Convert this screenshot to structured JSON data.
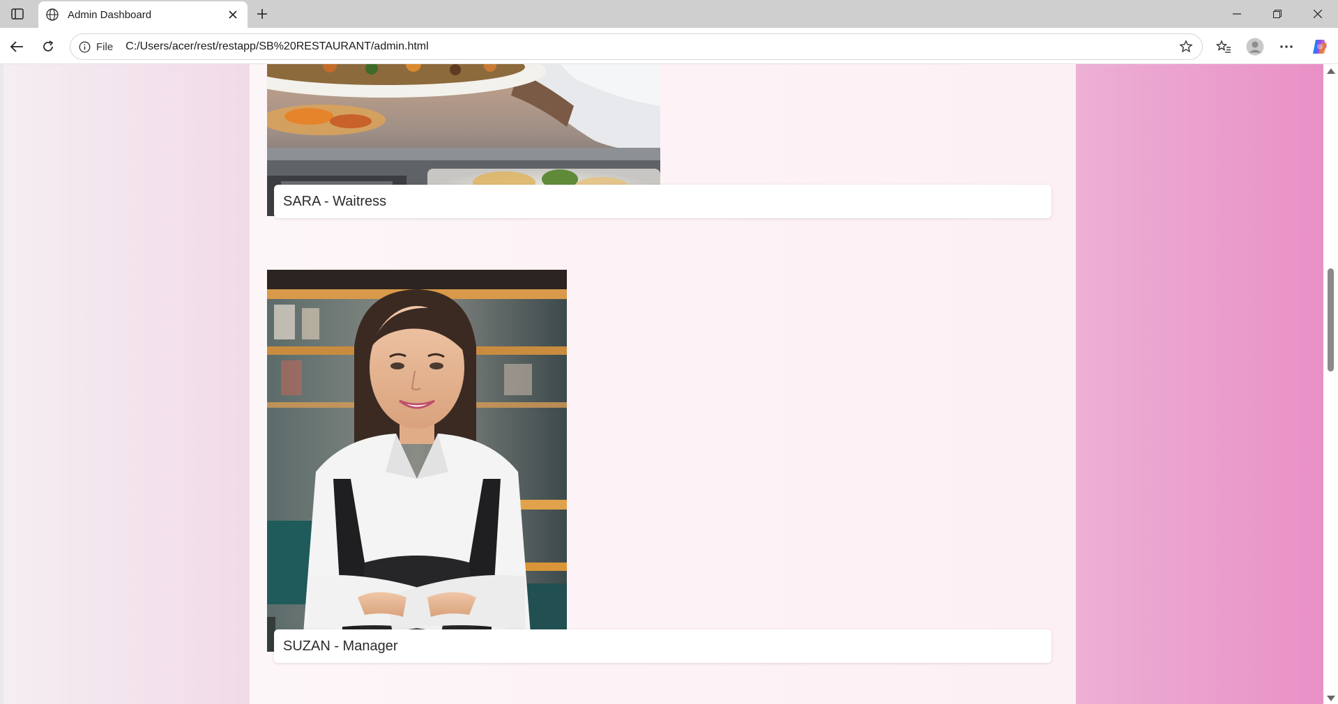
{
  "browser": {
    "tab_title": "Admin Dashboard",
    "address_scheme_label": "File",
    "url": "C:/Users/acer/rest/restapp/SB%20RESTAURANT/admin.html"
  },
  "page": {
    "staff": [
      {
        "label": "SARA - Waitress"
      },
      {
        "label": "SUZAN - Manager"
      }
    ]
  },
  "colors": {
    "tabbar": "#cfcfcf",
    "page_gradient_left": "#f2dbe8",
    "page_gradient_right": "#e98ec6",
    "card_bg": "#ffffff"
  },
  "icons": [
    "sidebar-toggle-icon",
    "globe-icon",
    "close-icon",
    "plus-icon",
    "minimize-icon",
    "restore-icon",
    "window-close-icon",
    "back-arrow-icon",
    "refresh-icon",
    "info-icon",
    "star-icon",
    "favorites-icon",
    "profile-icon",
    "more-icon",
    "copilot-icon"
  ]
}
